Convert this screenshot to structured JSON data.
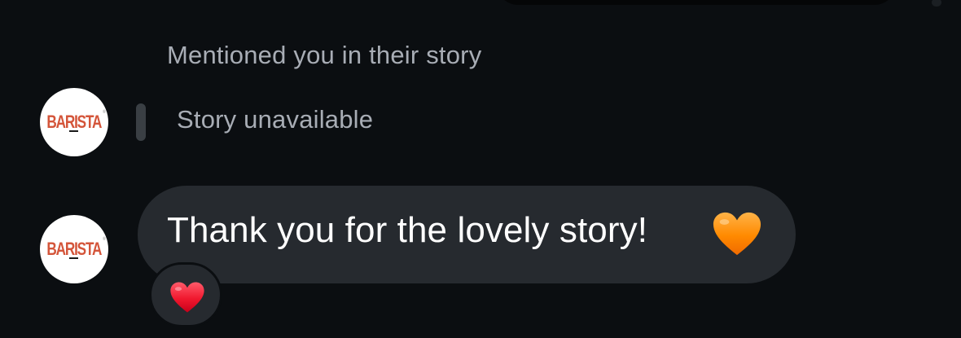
{
  "thread": {
    "mention_label": "Mentioned you in their story",
    "story_status": "Story unavailable",
    "sender": {
      "avatar_logo_text": "BARISTA",
      "brand_color": "#d4553a"
    },
    "message": {
      "text": "Thank you for the lovely story!",
      "emoji_icon": "orange-heart-icon",
      "bubble_color": "#262a2f"
    },
    "reaction": {
      "icon": "red-heart-icon"
    }
  },
  "colors": {
    "background": "#0b0e11",
    "secondary_text": "#a8adb5",
    "primary_text": "#ffffff",
    "orange_heart": "#ff8a00",
    "red_heart": "#f0182e"
  }
}
